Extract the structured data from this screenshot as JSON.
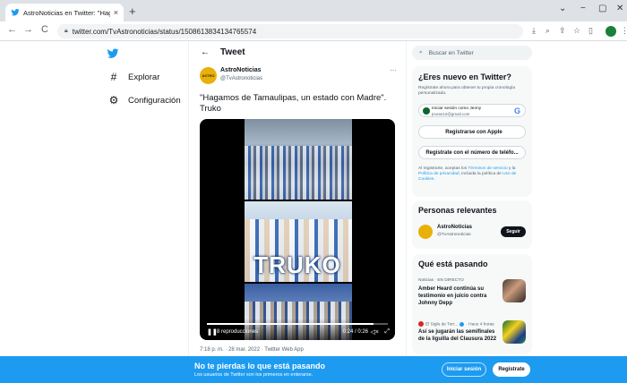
{
  "browser": {
    "tab_title": "AstroNoticias en Twitter: \"Haga",
    "tab_close": "×",
    "new_tab": "+",
    "url": "twitter.com/TvAstronoticias/status/1508613834134765574",
    "nav": {
      "back": "←",
      "forward": "→",
      "reload": "C"
    },
    "window": {
      "chevron": "⌄",
      "minimize": "−",
      "restore": "▢",
      "close": "✕"
    },
    "toolbar_icons": [
      "download",
      "zoom",
      "share",
      "star",
      "tab",
      "profile",
      "menu"
    ]
  },
  "sidebar": {
    "items": [
      {
        "label": "Explorar",
        "icon": "hashtag-icon"
      },
      {
        "label": "Configuración",
        "icon": "gear-icon"
      }
    ]
  },
  "tweet_header": {
    "title": "Tweet"
  },
  "tweet": {
    "author": "AstroNoticias",
    "handle": "@TvAstronoticias",
    "text": "\"Hagamos de Tamaulipas, un estado con Madre\". Truko",
    "video": {
      "overlay_text": "TRUKO",
      "views": "8 reproducciones",
      "time": "0:24 / 0:26",
      "progress": 0.92
    },
    "meta": "7:18 p. m. · 28 mar. 2022 · Twitter Web App"
  },
  "search": {
    "placeholder": "Buscar en Twitter"
  },
  "new_card": {
    "title": "¿Eres nuevo en Twitter?",
    "subtitle": "Regístrate ahora para obtener tu propia cronología personalizada.",
    "google_line1": "Iniciar sesión como Jenny",
    "google_line2": "jnoras12@gmail.com",
    "apple_label": "Registrarse con Apple",
    "phone_label": "Regístrate con el número de teléfo...",
    "legal_prefix": "Al registrarte, aceptas los ",
    "legal_terms": "Términos de servicio",
    "legal_mid": " y la ",
    "legal_privacy": "Política de privacidad",
    "legal_mid2": ", incluida la política de ",
    "legal_cookies": "Uso de Cookies",
    "legal_end": "."
  },
  "relevant": {
    "title": "Personas relevantes",
    "name": "AstroNoticias",
    "handle": "@TvAstronoticias",
    "follow": "Seguir"
  },
  "trends": {
    "title": "Qué está pasando",
    "items": [
      {
        "category": "Noticias · EN DIRECTO",
        "title": "Amber Heard continúa su testimonio en juicio contra Johnny Depp"
      },
      {
        "category_source": "El Siglo de Torr...",
        "category_time": "· Hace 4 horas",
        "title": "Así se jugarán las semifinales de la liguilla del Clausura 2022"
      }
    ]
  },
  "banner": {
    "title": "No te pierdas lo que está pasando",
    "subtitle": "Los usuarios de Twitter son los primeros en enterarse.",
    "login": "Iniciar sesión",
    "register": "Regístrate"
  }
}
